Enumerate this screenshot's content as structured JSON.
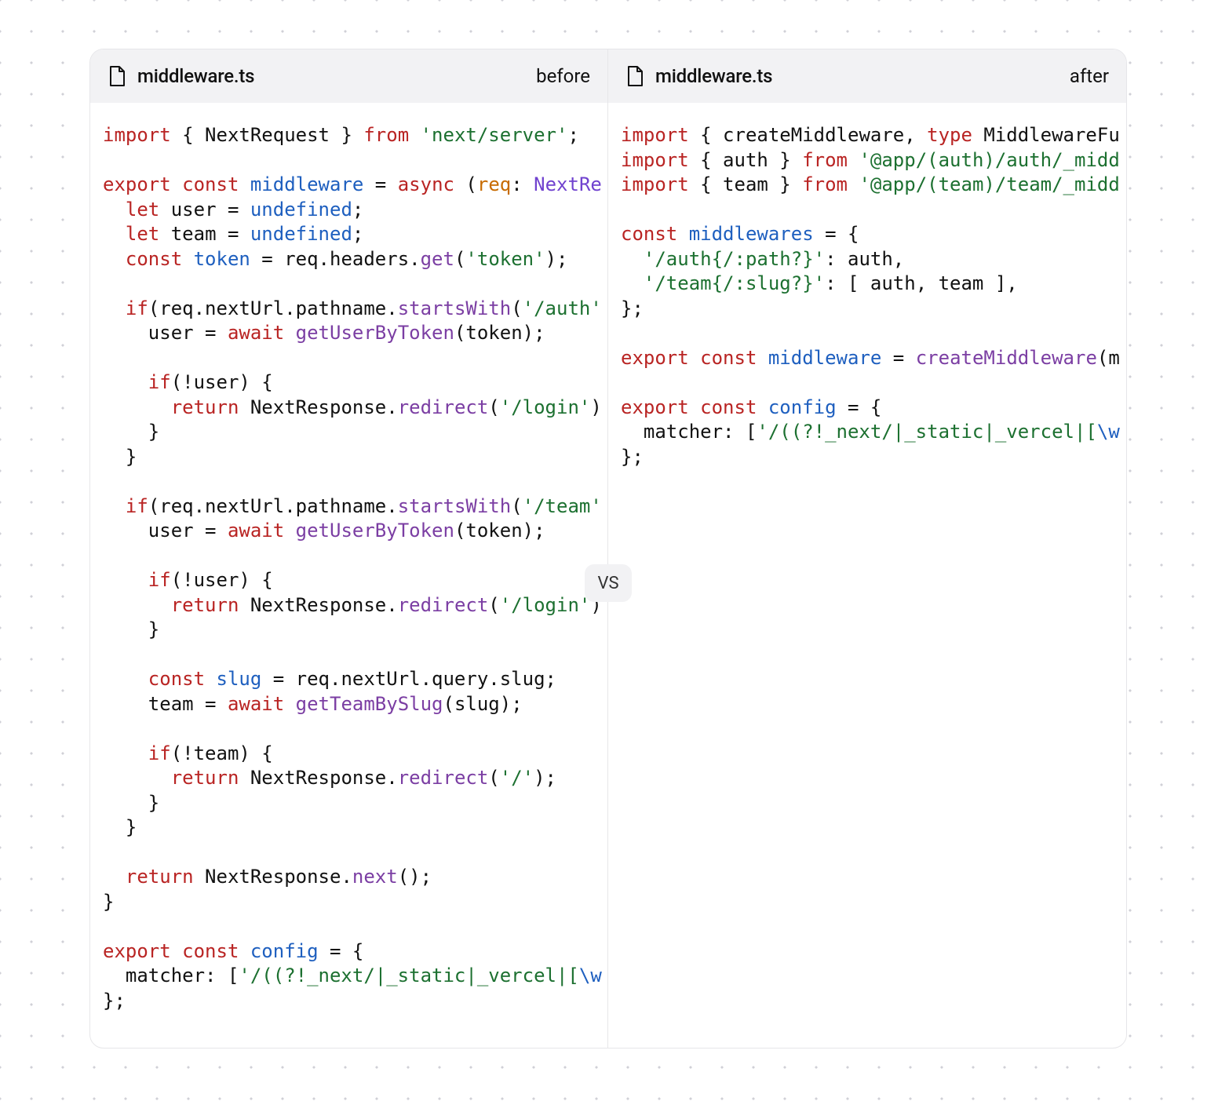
{
  "left_filename": "middleware.ts",
  "left_tag": "before",
  "right_filename": "middleware.ts",
  "right_tag": "after",
  "vs_label": "VS",
  "left_code": {
    "l1": {
      "a": "import",
      "b": " { NextRequest } ",
      "c": "from",
      "d": " ",
      "e": "'next/server'",
      "f": ";"
    },
    "l3a": "export",
    "l3b": " ",
    "l3c": "const",
    "l3d": " ",
    "l3e": "middleware",
    "l3f": " = ",
    "l3g": "async",
    "l3h": " (",
    "l3i": "req",
    "l3j": ": ",
    "l3k": "NextRe",
    "l4a": "let",
    "l4b": " user = ",
    "l4c": "undefined",
    "l4d": ";",
    "l5a": "let",
    "l5b": " team = ",
    "l5c": "undefined",
    "l5d": ";",
    "l6a": "const",
    "l6b": " ",
    "l6c": "token",
    "l6d": " = req.headers.",
    "l6e": "get",
    "l6f": "(",
    "l6g": "'token'",
    "l6h": ");",
    "l8a": "if",
    "l8b": "(req.nextUrl.pathname.",
    "l8c": "startsWith",
    "l8d": "(",
    "l8e": "'/auth'",
    "l9a": "    user = ",
    "l9b": "await",
    "l9c": " ",
    "l9d": "getUserByToken",
    "l9e": "(token);",
    "l11a": "if",
    "l11b": "(!user) {",
    "l12a": "return",
    "l12b": " NextResponse.",
    "l12c": "redirect",
    "l12d": "(",
    "l12e": "'/login'",
    "l12f": ")",
    "l13": "    }",
    "l14": "  }",
    "l16a": "if",
    "l16b": "(req.nextUrl.pathname.",
    "l16c": "startsWith",
    "l16d": "(",
    "l16e": "'/team'",
    "l17a": "    user = ",
    "l17b": "await",
    "l17c": " ",
    "l17d": "getUserByToken",
    "l17e": "(token);",
    "l19a": "if",
    "l19b": "(!user) {",
    "l20a": "return",
    "l20b": " NextResponse.",
    "l20c": "redirect",
    "l20d": "(",
    "l20e": "'/login'",
    "l20f": ")",
    "l21": "    }",
    "l23a": "const",
    "l23b": " ",
    "l23c": "slug",
    "l23d": " = req.nextUrl.query.slug;",
    "l24a": "    team = ",
    "l24b": "await",
    "l24c": " ",
    "l24d": "getTeamBySlug",
    "l24e": "(slug);",
    "l26a": "if",
    "l26b": "(!team) {",
    "l27a": "return",
    "l27b": " NextResponse.",
    "l27c": "redirect",
    "l27d": "(",
    "l27e": "'/'",
    "l27f": ");",
    "l28": "    }",
    "l29": "  }",
    "l31a": "return",
    "l31b": " NextResponse.",
    "l31c": "next",
    "l31d": "();",
    "l32": "}",
    "l34a": "export",
    "l34b": " ",
    "l34c": "const",
    "l34d": " ",
    "l34e": "config",
    "l34f": " = {",
    "l35a": "  matcher: [",
    "l35b": "'/((?!_next/|_static|_vercel|[",
    "l35c": "\\w",
    "l36": "};"
  },
  "right_code": {
    "r1a": "import",
    "r1b": " { createMiddleware, ",
    "r1c": "type",
    "r1d": " MiddlewareFu",
    "r2a": "import",
    "r2b": " { auth } ",
    "r2c": "from",
    "r2d": " ",
    "r2e": "'@app/(auth)/auth/_midd",
    "r3a": "import",
    "r3b": " { team } ",
    "r3c": "from",
    "r3d": " ",
    "r3e": "'@app/(team)/team/_midd",
    "r5a": "const",
    "r5b": " ",
    "r5c": "middlewares",
    "r5d": " = {",
    "r6a": "  ",
    "r6b": "'/auth{/:path?}'",
    "r6c": ": auth,",
    "r7a": "  ",
    "r7b": "'/team{/:slug?}'",
    "r7c": ": [ auth, team ],",
    "r8": "};",
    "r10a": "export",
    "r10b": " ",
    "r10c": "const",
    "r10d": " ",
    "r10e": "middleware",
    "r10f": " = ",
    "r10g": "createMiddleware",
    "r10h": "(m",
    "r12a": "export",
    "r12b": " ",
    "r12c": "const",
    "r12d": " ",
    "r12e": "config",
    "r12f": " = {",
    "r13a": "  matcher: [",
    "r13b": "'/((?!_next/|_static|_vercel|[",
    "r13c": "\\w",
    "r14": "};"
  }
}
